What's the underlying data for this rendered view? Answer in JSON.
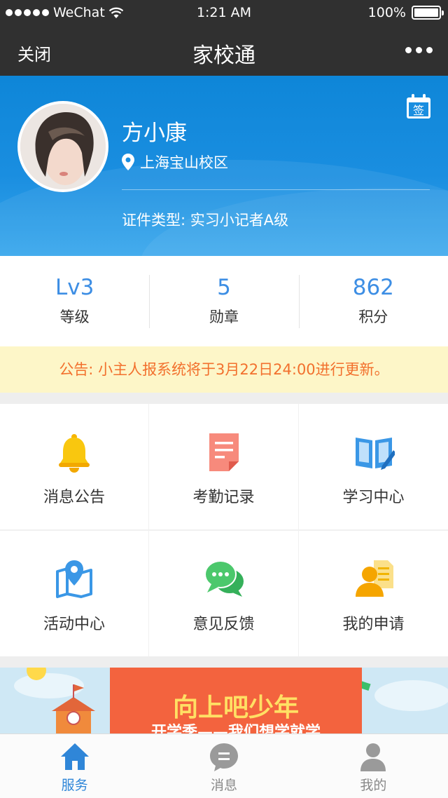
{
  "status_bar": {
    "carrier": "WeChat",
    "time": "1:21 AM",
    "battery": "100%"
  },
  "nav": {
    "close": "关闭",
    "title": "家校通"
  },
  "profile": {
    "name": "方小康",
    "location": "上海宝山校区",
    "cert": "证件类型: 实习小记者A级",
    "sign_label": "签"
  },
  "stats": [
    {
      "value": "Lv3",
      "label": "等级"
    },
    {
      "value": "5",
      "label": "勋章"
    },
    {
      "value": "862",
      "label": "积分"
    }
  ],
  "notice": "公告: 小主人报系统将于3月22日24:00进行更新。",
  "menu": [
    {
      "label": "消息公告",
      "icon": "bell-icon"
    },
    {
      "label": "考勤记录",
      "icon": "document-icon"
    },
    {
      "label": "学习中心",
      "icon": "book-icon"
    },
    {
      "label": "活动中心",
      "icon": "map-location-icon"
    },
    {
      "label": "意见反馈",
      "icon": "chat-icon"
    },
    {
      "label": "我的申请",
      "icon": "application-icon"
    }
  ],
  "banner": {
    "title": "向上吧少年",
    "subtitle": "开学季——我们想学就学"
  },
  "tabs": [
    {
      "label": "服务",
      "icon": "home-icon",
      "active": true
    },
    {
      "label": "消息",
      "icon": "message-icon",
      "active": false
    },
    {
      "label": "我的",
      "icon": "user-icon",
      "active": false
    }
  ],
  "colors": {
    "accent": "#2f86d8",
    "header_bar": "#303030",
    "notice_text": "#f2702d",
    "notice_bg": "#fdf6c8"
  }
}
